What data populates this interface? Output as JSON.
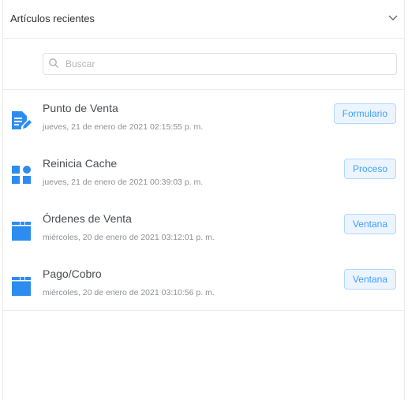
{
  "header": {
    "title": "Artículos recientes"
  },
  "search": {
    "placeholder": "Buscar",
    "value": ""
  },
  "items": [
    {
      "title": "Punto de Venta",
      "date": "jueves, 21 de enero de 2021 02:15:55 p. m.",
      "badge": "Formulario",
      "icon": "form-edit-icon"
    },
    {
      "title": "Reinicia Cache",
      "date": "jueves, 21 de enero de 2021 00:39:03 p. m.",
      "badge": "Proceso",
      "icon": "process-icon"
    },
    {
      "title": "Órdenes de Venta",
      "date": "miércoles, 20 de enero de 2021 03:12:01 p. m.",
      "badge": "Ventana",
      "icon": "window-icon"
    },
    {
      "title": "Pago/Cobro",
      "date": "miércoles, 20 de enero de 2021 03:10:56 p. m.",
      "badge": "Ventana",
      "icon": "window-icon"
    }
  ],
  "colors": {
    "accent": "#409eff",
    "badge_bg": "#ecf5ff",
    "icon": "#2d8cf0"
  }
}
